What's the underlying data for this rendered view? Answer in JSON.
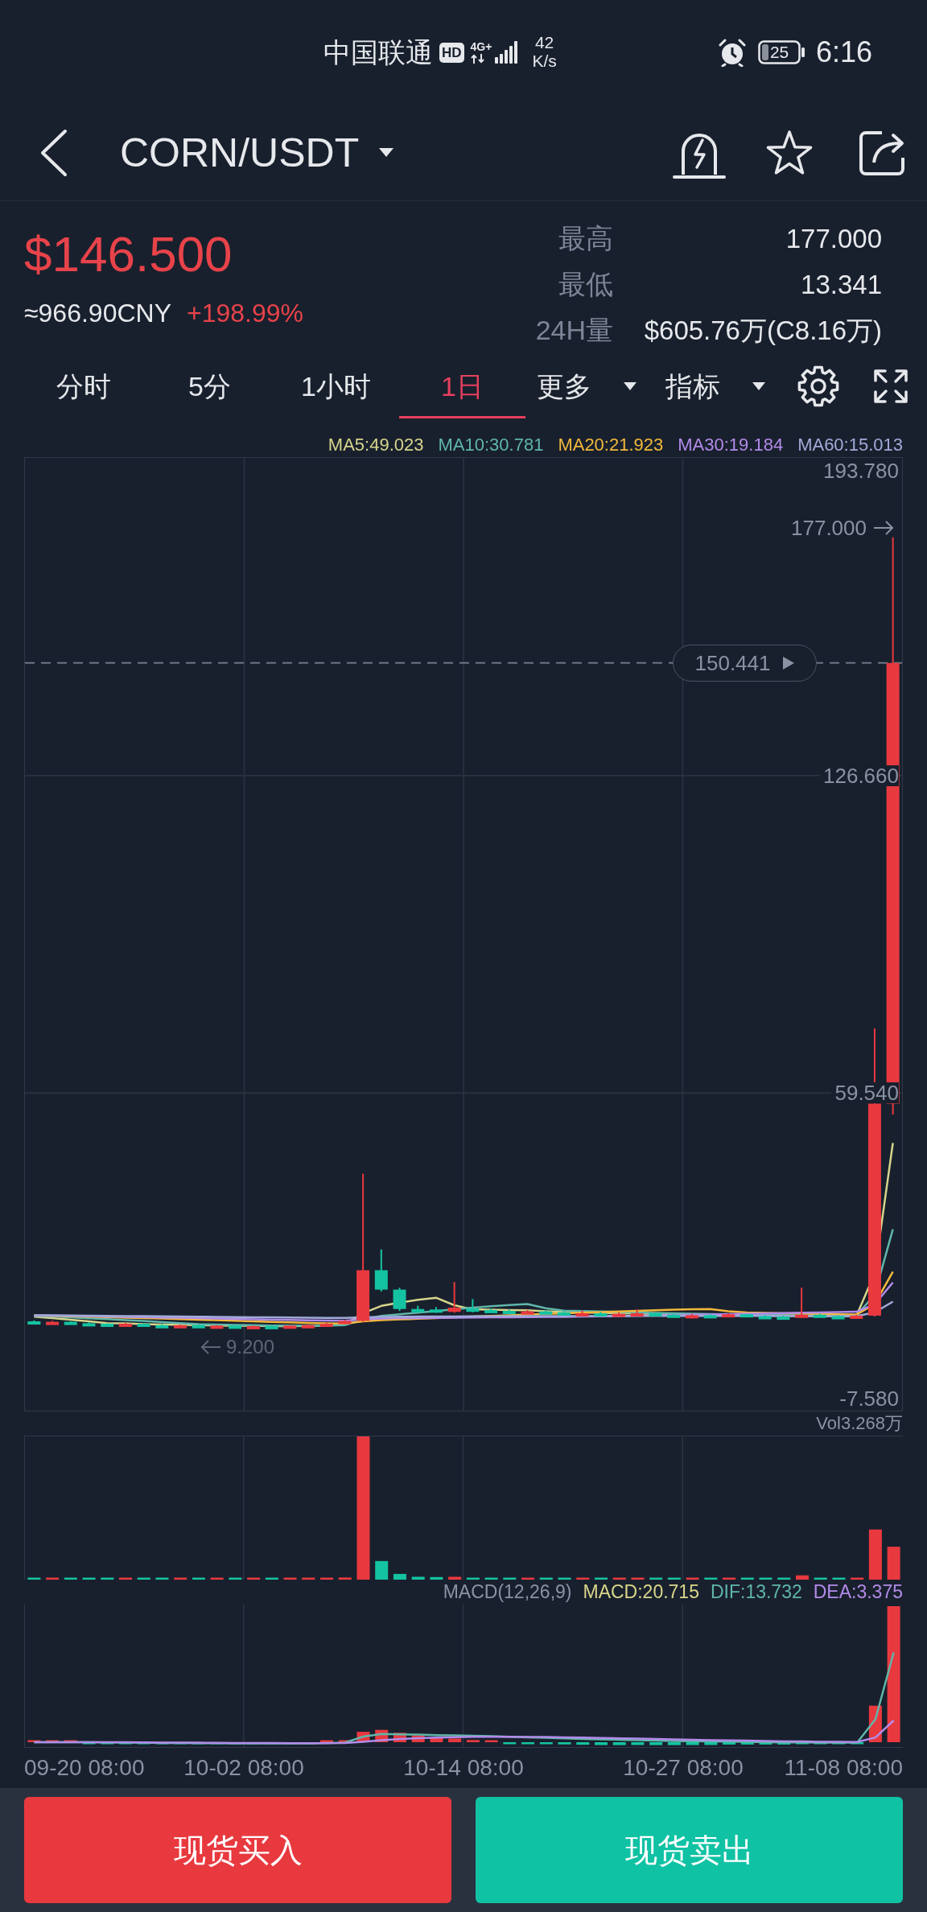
{
  "status_bar": {
    "carrier": "中国联通",
    "hd_badge": "HD",
    "network": "4G+",
    "speed": "42",
    "speed_unit": "K/s",
    "battery": "25",
    "time": "6:16"
  },
  "header": {
    "pair": "CORN/USDT"
  },
  "price": {
    "last": "$146.500",
    "cny": "≈966.90CNY",
    "change": "+198.99%"
  },
  "stats": [
    {
      "label": "最高",
      "value": "177.000"
    },
    {
      "label": "最低",
      "value": "13.341"
    },
    {
      "label": "24H量",
      "value": "$605.76万(C8.16万)"
    }
  ],
  "intervals": [
    {
      "label": "分时",
      "kind": "tab",
      "selected": false
    },
    {
      "label": "5分",
      "kind": "tab",
      "selected": false
    },
    {
      "label": "1小时",
      "kind": "tab",
      "selected": false
    },
    {
      "label": "1日",
      "kind": "tab",
      "selected": true
    },
    {
      "label": "更多",
      "kind": "menu",
      "selected": false
    },
    {
      "label": "指标",
      "kind": "menu",
      "selected": false
    }
  ],
  "chart": {
    "ma_legend": [
      {
        "label": "MA5:49.023",
        "color": "#d6d58c"
      },
      {
        "label": "MA10:30.781",
        "color": "#5fb6aa"
      },
      {
        "label": "MA20:21.923",
        "color": "#f2b93c"
      },
      {
        "label": "MA30:19.184",
        "color": "#b28bea"
      },
      {
        "label": "MA60:15.013",
        "color": "#a1abd9"
      }
    ],
    "price_axis": [
      "193.780",
      "126.660",
      "59.540",
      "-7.580"
    ],
    "high_marker": "177.000",
    "low_marker": "9.200",
    "current_price": "150.441",
    "volume_label": "Vol3.268万",
    "macd_legend": [
      {
        "label": "MACD(12,26,9)",
        "color": "#8a93a6"
      },
      {
        "label": "MACD:20.715",
        "color": "#d9d68a"
      },
      {
        "label": "DIF:13.732",
        "color": "#5fb6aa"
      },
      {
        "label": "DEA:3.375",
        "color": "#b28bea"
      }
    ],
    "time_axis": [
      "09-20 08:00",
      "10-02 08:00",
      "10-14 08:00",
      "10-27 08:00",
      "11-08 08:00"
    ]
  },
  "actions": [
    {
      "label": "现货买入",
      "kind": "buy"
    },
    {
      "label": "现货卖出",
      "kind": "sell"
    }
  ]
}
